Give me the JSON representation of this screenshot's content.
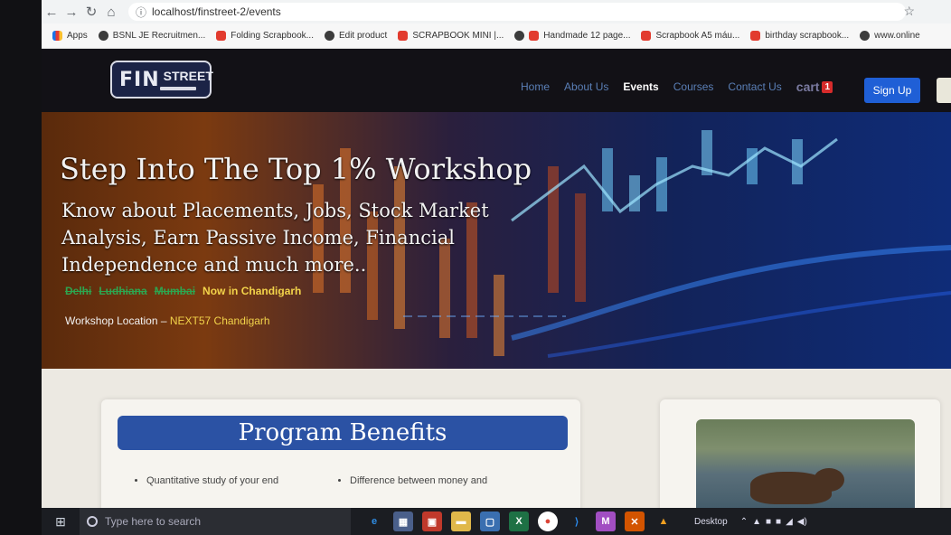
{
  "browser": {
    "url": "localhost/finstreet-2/events",
    "bookmarks": [
      {
        "label": "Apps",
        "icon": "apps-grid-icon"
      },
      {
        "label": "BSNL JE Recruitmen...",
        "icon": "globe-icon"
      },
      {
        "label": "Folding Scrapbook...",
        "icon": "youtube-icon"
      },
      {
        "label": "Edit product",
        "icon": "globe-icon"
      },
      {
        "label": "SCRAPBOOK MINI |...",
        "icon": "youtube-icon"
      },
      {
        "label": "Handmade 12 page...",
        "icon": "youtube-icon"
      },
      {
        "label": "Scrapbook A5 máu...",
        "icon": "youtube-icon"
      },
      {
        "label": "birthday scrapbook...",
        "icon": "youtube-icon"
      },
      {
        "label": "www.online",
        "icon": "bookmark-icon"
      }
    ]
  },
  "site": {
    "logo": {
      "fin": "FIN",
      "street": "STREET"
    },
    "nav": [
      {
        "label": "Home",
        "active": false
      },
      {
        "label": "About Us",
        "active": false
      },
      {
        "label": "Events",
        "active": true
      },
      {
        "label": "Courses",
        "active": false
      },
      {
        "label": "Contact Us",
        "active": false
      }
    ],
    "cart_label": "cart",
    "cart_count": "1",
    "signup_label": "Sign Up"
  },
  "hero": {
    "title": "Step Into The Top 1% Workshop",
    "subtitle": "Know about Placements, Jobs, Stock Market Analysis, Earn Passive Income, Financial Independence and much more..",
    "past_cities": [
      "Delhi",
      "Ludhiana",
      "Mumbai"
    ],
    "current_city": "Now in Chandigarh",
    "location_label": "Workshop Location – ",
    "location_value": "NEXT57 Chandigarh"
  },
  "benefits": {
    "title": "Program Benefits",
    "items": [
      "Quantitative study of your end",
      "Difference between money and"
    ]
  },
  "taskbar": {
    "search_placeholder": "Type here to search",
    "desktop_label": "Desktop"
  },
  "colors": {
    "accent": "#1f5fd6",
    "nav_link": "#5a7fb6",
    "highlight": "#f2d34a",
    "strike": "#2ea44f"
  }
}
